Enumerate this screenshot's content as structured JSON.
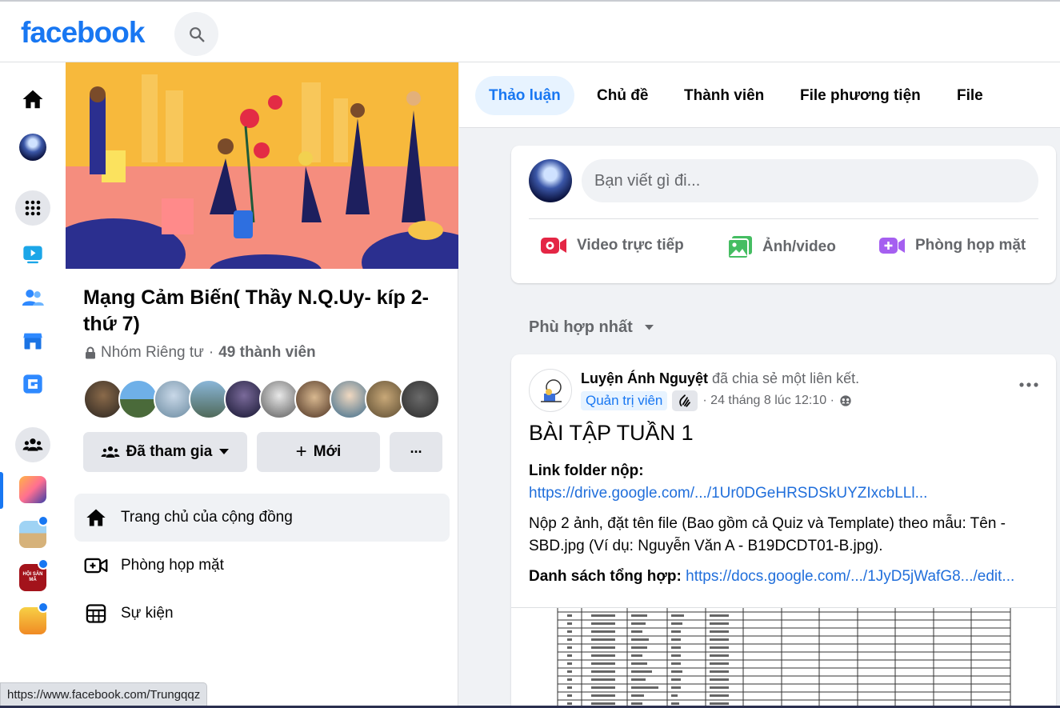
{
  "header": {
    "logo": "facebook"
  },
  "rail": {
    "items": [
      "home-icon",
      "profile-avatar",
      "menu-grid-icon",
      "watch-icon",
      "friends-icon",
      "marketplace-icon",
      "gaming-icon",
      "groups-icon",
      "group-shortcut-1",
      "group-shortcut-2",
      "group-shortcut-3",
      "group-shortcut-4"
    ],
    "shortcut_3_text": "HỘI SĂN MÃ"
  },
  "group": {
    "title": "Mạng Cảm Biến( Thầy N.Q.Uy- kíp 2- thứ 7)",
    "privacy": "Nhóm Riêng tư",
    "separator": "·",
    "member_count": "49 thành viên",
    "joined_label": "Đã tham gia",
    "invite_label": "Mới",
    "more_label": "···",
    "menu": [
      {
        "label": "Trang chủ của cộng đồng"
      },
      {
        "label": "Phòng họp mặt"
      },
      {
        "label": "Sự kiện"
      }
    ]
  },
  "tabs": [
    "Thảo luận",
    "Chủ đề",
    "Thành viên",
    "File phương tiện",
    "File"
  ],
  "composer": {
    "placeholder": "Bạn viết gì đi...",
    "actions": [
      "Video trực tiếp",
      "Ảnh/video",
      "Phòng họp mặt"
    ]
  },
  "sort": {
    "label": "Phù hợp nhất"
  },
  "post": {
    "author": "Luyện Ánh Nguyệt",
    "action": " đã chia sẻ một liên kết.",
    "badge": "Quản trị viên",
    "time": "· 24 tháng 8 lúc 12:10 ·",
    "heading": "BÀI TẬP TUẦN 1",
    "folder_label": "Link folder nộp:",
    "folder_link": "https://drive.google.com/.../1Ur0DGeHRSDSkUYZIxcbLLl...",
    "instruction": "Nộp 2 ảnh, đặt tên file (Bao gồm cả Quiz và Template) theo mẫu: Tên - SBD.jpg (Ví dụ: Nguyễn Văn A - B19DCDT01-B.jpg).",
    "list_label": "Danh sách tổng hợp:",
    "list_link": "https://docs.google.com/.../1JyD5jWafG8.../edit..."
  },
  "status_bar": {
    "url": "https://www.facebook.com/Trungqqz"
  },
  "colors": {
    "brand": "#1877f2",
    "link": "#216fdb",
    "tab_active_bg": "#e7f3ff"
  }
}
